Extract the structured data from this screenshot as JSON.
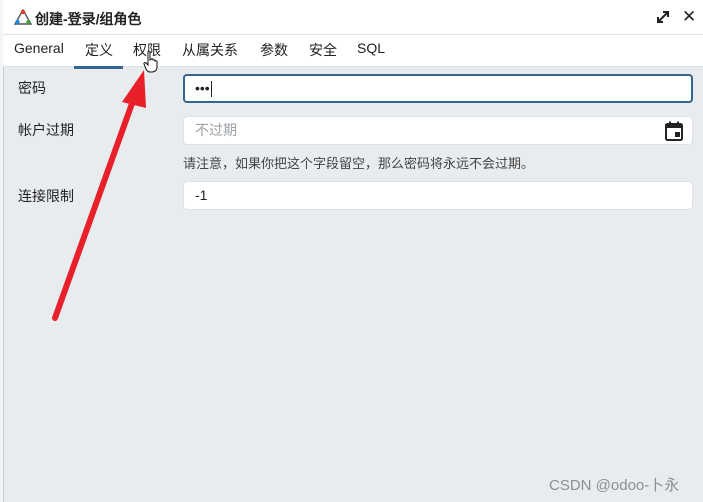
{
  "window": {
    "title": "创建-登录/组角色",
    "close_glyph": "✕"
  },
  "tabs": [
    {
      "label": "General"
    },
    {
      "label": "定义"
    },
    {
      "label": "权限"
    },
    {
      "label": "从属关系"
    },
    {
      "label": "参数"
    },
    {
      "label": "安全"
    },
    {
      "label": "SQL"
    }
  ],
  "active_tab": "定义",
  "form": {
    "password": {
      "label": "密码",
      "value": "•••"
    },
    "expiry": {
      "label": "帐户过期",
      "placeholder": "不过期",
      "help": "请注意，如果你把这个字段留空，那么密码将永远不会过期。"
    },
    "conn_limit": {
      "label": "连接限制",
      "value": "-1"
    }
  },
  "colors": {
    "accent": "#326690",
    "annotation_arrow": "#e8202a",
    "background": "#e9ecef"
  },
  "icons": [
    "app-icon",
    "expand-icon",
    "close-icon",
    "calendar-icon",
    "hand-cursor-icon"
  ],
  "watermark": "CSDN @odoo-卜永"
}
